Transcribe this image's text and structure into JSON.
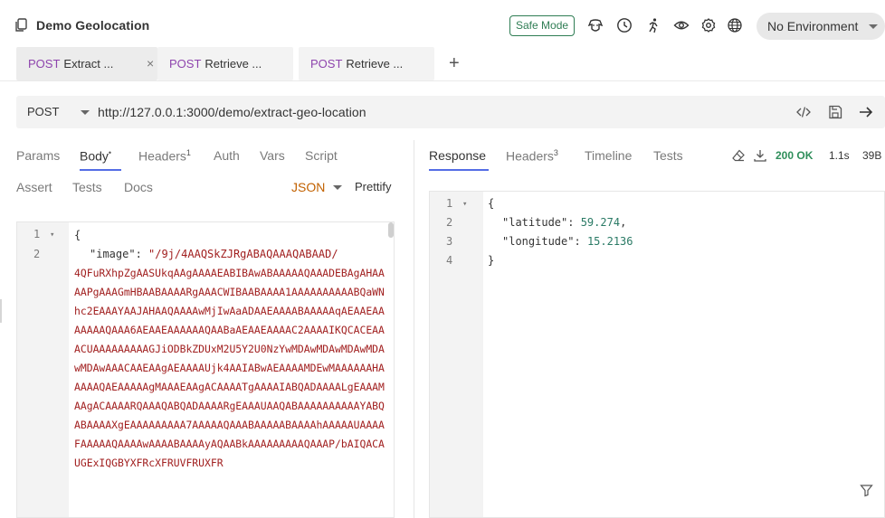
{
  "collection": {
    "title": "Demo Geolocation",
    "icon": "copy-icon"
  },
  "header": {
    "safe_mode": "Safe Mode",
    "icons": [
      "dog-icon",
      "clock-icon",
      "runner-icon",
      "eye-icon",
      "gear-icon",
      "globe-icon"
    ],
    "environment": "No Environment"
  },
  "tabs": [
    {
      "method": "POST",
      "name": "Extract ...",
      "active": true
    },
    {
      "method": "POST",
      "name": "Retrieve ...",
      "active": false
    },
    {
      "method": "POST",
      "name": "Retrieve ...",
      "active": false
    }
  ],
  "tab_close": "×",
  "new_tab": "+",
  "request": {
    "method": "POST",
    "url": "http://127.0.0.1:3000/demo/extract-geo-location",
    "tabs": {
      "params": "Params",
      "body": "Body",
      "body_dot": "•",
      "headers": "Headers",
      "headers_count": "1",
      "auth": "Auth",
      "vars": "Vars",
      "script": "Script",
      "assert": "Assert",
      "tests": "Tests",
      "docs": "Docs"
    },
    "body_mode": "JSON",
    "prettify": "Prettify",
    "body": {
      "line_numbers": [
        "1",
        "2"
      ],
      "brace_open": "{",
      "key": "\"image\"",
      "colon": ": ",
      "value_start": "\"/9j/4AAQSkZJRgABAQAAAQABAAD/",
      "value_rest": "4QFuRXhpZgAASUkqAAgAAAAEABIBAwABAAAAAQAAADEBAgAHAAAAPgAAAGmHBAABAAAARgAAACWIBAABAAAA1AAAAAAAAAABQaWNhc2EAAAYAAJAHAAQAAAAwMjIwAaADAAEAAAABAAAAAqAEAAEAAAAAAAQAAA6AEAAEAAAAAAQAABaAEAAEAAAAC2AAAAIKQCACEAAACUAAAAAAAAAGJiODBkZDUxM2U5Y2U0NzYwMDAwMDAwMDAwMDAwMDAwAAACAAEAAgAEAAAAUjk4AAIABwAEAAAAMDEwMAAAAAAHAAAAAQAEAAAAAgMAAAEAAgACAAAATgAAAAIABQADAAAALgEAAAMAAgACAAAARQAAAQABQADAAAARgEAAAUAAQABAAAAAAAAAAYABQABAAAAXgEAAAAAAAAA7AAAAAQAAABAAAAABAAAAhAAAAAUAAAAFAAAAAQAAAAwAAAABAAAAyAQAABkAAAAAAAAAQAAAP/bAIQACAUGExIQGBYXFRcXFRUVFRUXFR"
    }
  },
  "response": {
    "tabs": {
      "response": "Response",
      "headers": "Headers",
      "headers_count": "3",
      "timeline": "Timeline",
      "tests": "Tests"
    },
    "status": "200 OK",
    "time": "1.1s",
    "size": "39B",
    "body": {
      "line_numbers": [
        "1",
        "2",
        "3",
        "4"
      ],
      "open": "{",
      "lat_key": "\"latitude\"",
      "lat_value": "59.274",
      "lon_key": "\"longitude\"",
      "lon_value": "15.2136",
      "close": "}"
    }
  }
}
